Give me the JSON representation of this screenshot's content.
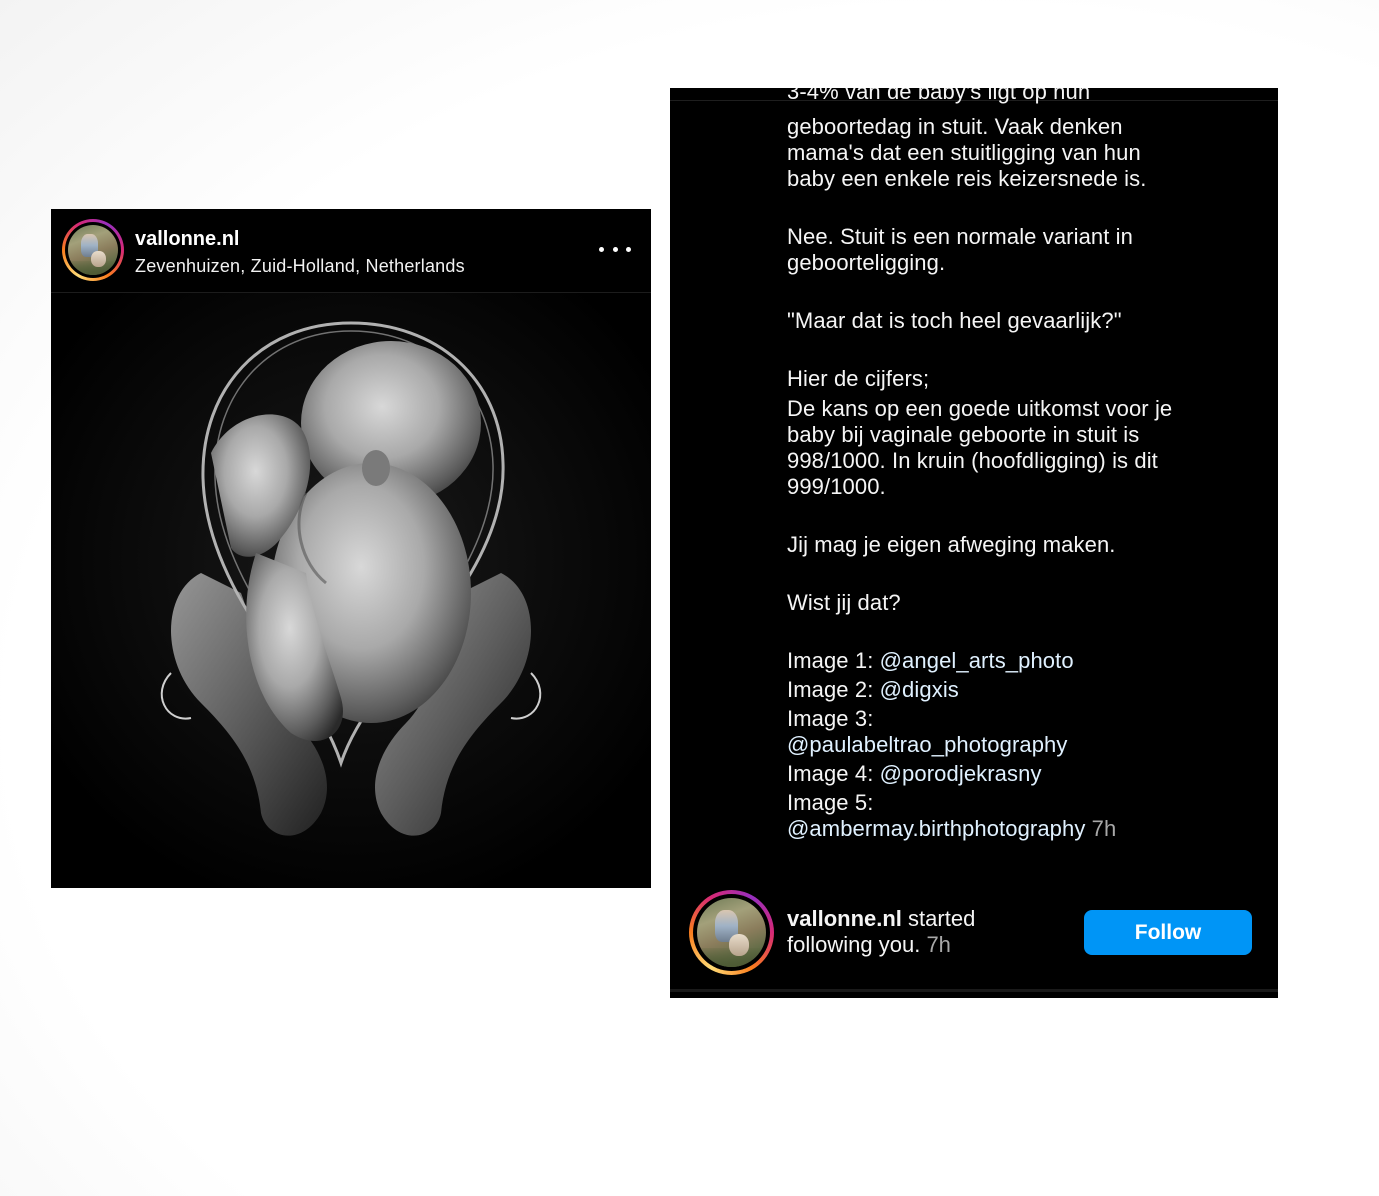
{
  "post": {
    "username": "vallonne.nl",
    "location": "Zevenhuizen, Zuid-Holland, Netherlands",
    "more_icon": "more-horizontal-icon"
  },
  "caption": {
    "cut_line": "3-4% van de baby's ligt op hun",
    "paragraphs": [
      "geboortedag in stuit. Vaak denken mama's dat een stuitligging van hun baby een enkele reis keizersnede is.",
      "Nee. Stuit is een normale variant in geboorteligging.",
      "\"Maar dat is toch heel gevaarlijk?\""
    ],
    "numbers_intro": "Hier de cijfers;",
    "numbers_body": "De kans op een goede uitkomst voor je baby bij vaginale geboorte in stuit is 998/1000. In kruin (hoofdligging) is dit 999/1000.",
    "closing": [
      "Jij mag je eigen afweging maken.",
      "Wist jij dat?"
    ],
    "credits": [
      {
        "label": "Image 1:",
        "handle": "@angel_arts_photo"
      },
      {
        "label": "Image 2:",
        "handle": "@digxis"
      },
      {
        "label": "Image 3:",
        "handle": "@paulabeltrao_photography"
      },
      {
        "label": "Image 4:",
        "handle": "@porodjekrasny"
      },
      {
        "label": "Image 5:",
        "handle": "@ambermay.birthphotography"
      }
    ],
    "time": "7h"
  },
  "notification": {
    "username": "vallonne.nl",
    "text": "started following you.",
    "time": "7h",
    "follow_label": "Follow"
  },
  "colors": {
    "background": "#000000",
    "follow_button": "#0095f6",
    "handle_text": "#e0f1ff",
    "muted_text": "#a8a8a8"
  }
}
